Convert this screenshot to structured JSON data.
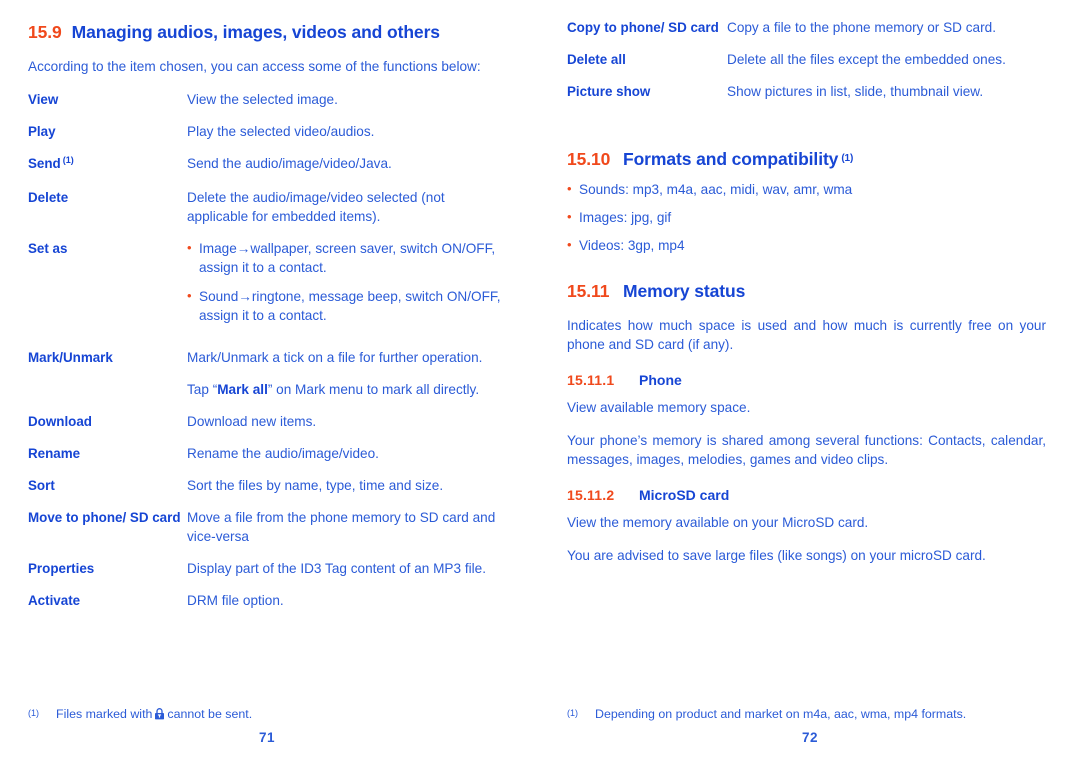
{
  "colors": {
    "orange": "#f0491c",
    "heading_blue": "#1645d4",
    "body_blue": "#2b5bd7"
  },
  "left_page": {
    "heading": {
      "number": "15.9",
      "title": "Managing audios, images, videos and others"
    },
    "intro": "According to the item chosen, you can access some of the functions below:",
    "items": [
      {
        "term": "View",
        "sup": "",
        "desc": "View the selected image."
      },
      {
        "term": "Play",
        "sup": "",
        "desc": "Play the selected video/audios."
      },
      {
        "term": "Send",
        "sup": "(1)",
        "desc": "Send the audio/image/video/Java."
      },
      {
        "term": "Delete",
        "sup": "",
        "desc": "Delete the audio/image/video selected (not applicable for embedded items)."
      },
      {
        "term": "Set as",
        "sup": "",
        "bullets": [
          "Image→wallpaper, screen saver, switch ON/OFF, assign it to a contact.",
          "Sound→ringtone, message beep, switch ON/OFF, assign it to a contact."
        ]
      },
      {
        "term": "Mark/Unmark",
        "sup": "",
        "desc": "Mark/Unmark a tick on a file for further operation.",
        "desc2_pre": "Tap “",
        "desc2_bold": "Mark all",
        "desc2_post": "” on Mark menu to mark all directly."
      },
      {
        "term": "Download",
        "sup": "",
        "desc": "Download new items."
      },
      {
        "term": "Rename",
        "sup": "",
        "desc": "Rename the audio/image/video."
      },
      {
        "term": "Sort",
        "sup": "",
        "desc": "Sort the files by name, type, time and size."
      },
      {
        "term": "Move to phone/ SD card",
        "sup": "",
        "desc": "Move a file from the phone memory to SD card and vice-versa"
      },
      {
        "term": "Properties",
        "sup": "",
        "desc": "Display part of the ID3 Tag content of an MP3 file."
      },
      {
        "term": "Activate",
        "sup": "",
        "desc": "DRM file option."
      }
    ],
    "footnote": {
      "mark": "(1)",
      "text_before": "Files marked with",
      "icon": "lock-icon",
      "text_after": "cannot be sent."
    },
    "page_number": "71"
  },
  "right_page": {
    "items": [
      {
        "term": "Copy to phone/ SD card",
        "desc": "Copy a file to the phone memory or SD card."
      },
      {
        "term": "Delete all",
        "desc": "Delete all the files except the embedded ones."
      },
      {
        "term": "Picture show",
        "desc": "Show pictures in list, slide, thumbnail view."
      }
    ],
    "formats_heading": {
      "number": "15.10",
      "title": "Formats and compatibility",
      "sup": "(1)"
    },
    "formats_bullets": [
      "Sounds: mp3, m4a, aac, midi, wav, amr, wma",
      "Images: jpg, gif",
      "Videos: 3gp, mp4"
    ],
    "memory_heading": {
      "number": "15.11",
      "title": "Memory status"
    },
    "memory_intro": "Indicates how much space is used and how much is currently free on your phone and SD card (if any).",
    "phone_heading": {
      "number": "15.11.1",
      "title": "Phone"
    },
    "phone_p1": "View available memory space.",
    "phone_p2": "Your phone’s memory is shared among several functions: Contacts, calendar, messages, images, melodies, games and video clips.",
    "sd_heading": {
      "number": "15.11.2",
      "title": "MicroSD card"
    },
    "sd_p1": "View the memory available on your MicroSD card.",
    "sd_p2": "You are advised to save large files (like songs) on your microSD card.",
    "footnote": {
      "mark": "(1)",
      "text": "Depending on product and market on m4a, aac, wma, mp4 formats."
    },
    "page_number": "72"
  }
}
